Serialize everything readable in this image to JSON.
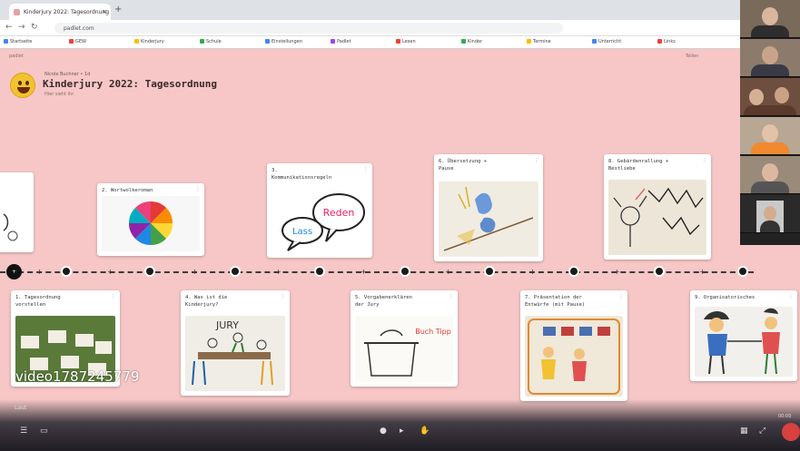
{
  "browser": {
    "tab_title": "Kinderjury 2022: Tagesordnung",
    "address": "padlet.com",
    "bookmarks": [
      "Startseite",
      "GEW",
      "Kinderjury",
      "Schule",
      "Einstellungen",
      "Padlet",
      "Lesen",
      "Kinder",
      "Termine",
      "Unterricht",
      "Links"
    ]
  },
  "padlet": {
    "top_left": "padlet",
    "share_label": "Teilen",
    "author": "Nicole Buchner • 1d",
    "title": "Kinderjury 2022: Tagesordnung",
    "subtitle": "Hier sieht ihr"
  },
  "timeline": {
    "start_label": "+"
  },
  "cards_top": [
    {
      "title": "2. Wortwolkeroman"
    },
    {
      "title": "3.\nKommunikationsregeln"
    },
    {
      "title": "6. Übersetzung +\nPause"
    },
    {
      "title": "8. Gebärdenrallung +\nBestliebe"
    }
  ],
  "cards_bottom": [
    {
      "title": "1. Tagesordnung\nvorstellen"
    },
    {
      "title": "4. Was ist die\nKinderjury?"
    },
    {
      "title": "5. Vorgabenerklären\nder Jury"
    },
    {
      "title": "7. Präsentation der\nEntwürfe (mit Pause)"
    },
    {
      "title": "9. Organisatorisches"
    }
  ],
  "card_texts": {
    "speech_text_1": "Lass",
    "speech_text_2": "Reden",
    "jury_text": "JURY",
    "pot_text": "Buch Tipp"
  },
  "call": {
    "watermark": "video1787245779",
    "left_label": "Laut",
    "right_label": "00:00"
  },
  "colors": {
    "background": "#f6c7c6",
    "accent": "#d94040"
  }
}
